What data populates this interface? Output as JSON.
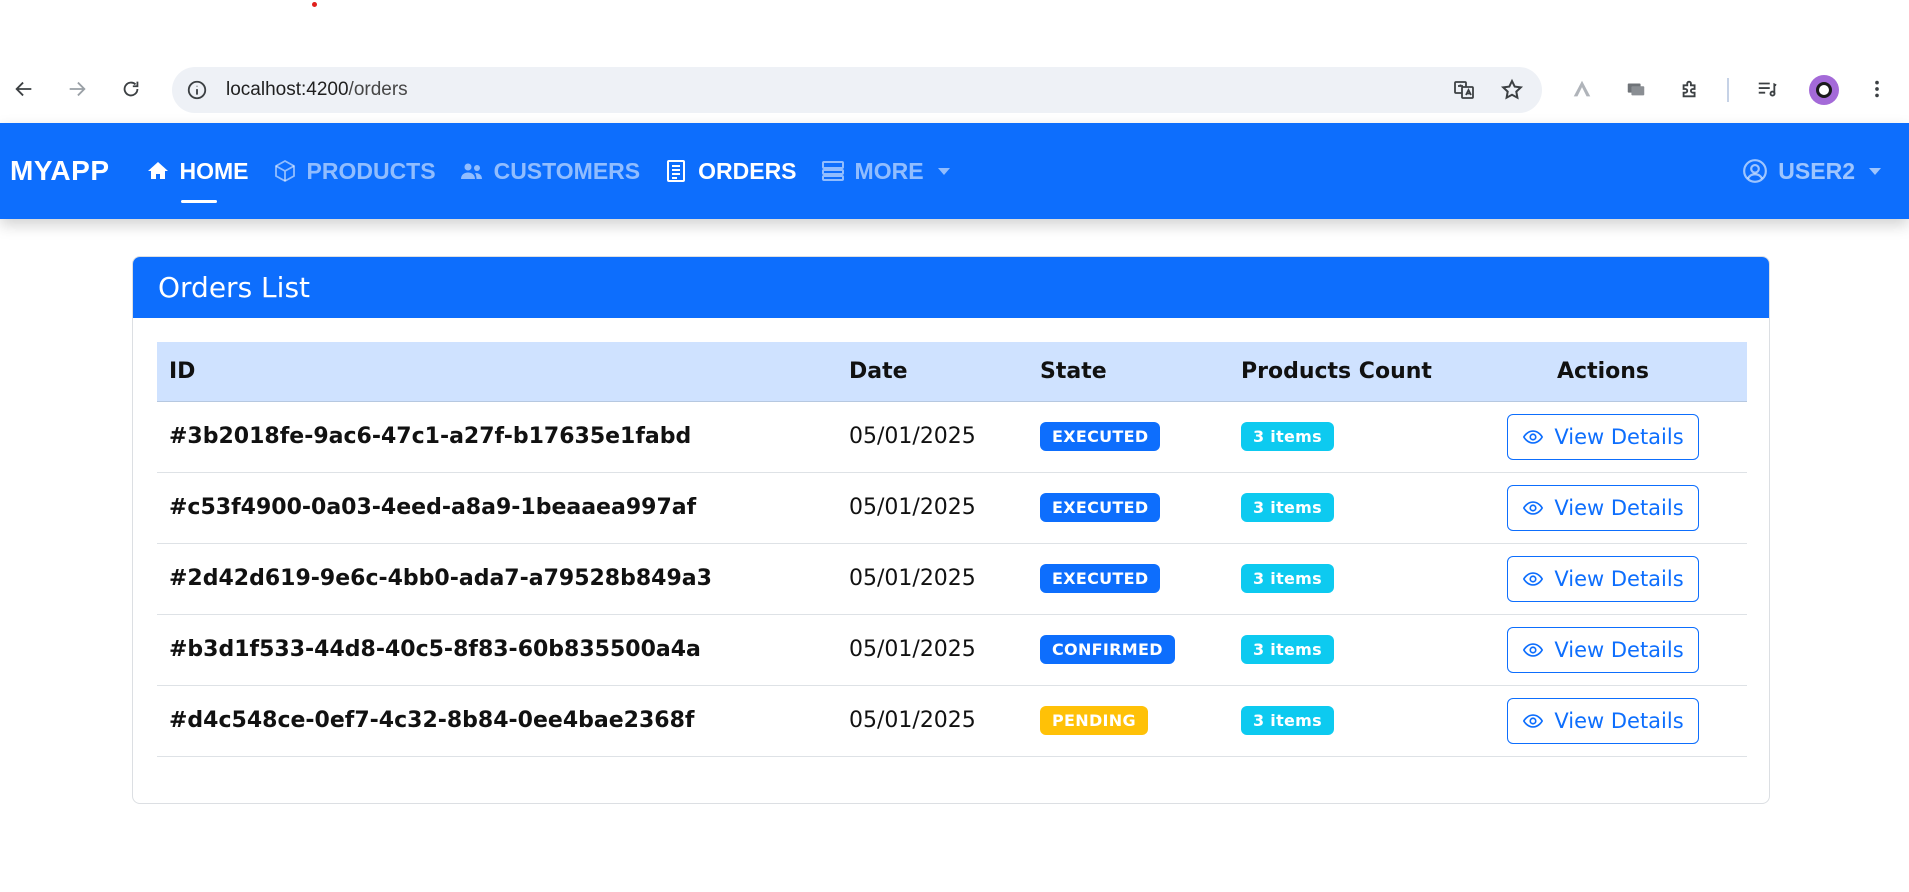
{
  "browser": {
    "url_host": "localhost:4200",
    "url_path": "/orders"
  },
  "navbar": {
    "brand": "MYAPP",
    "links": [
      {
        "label": "HOME",
        "icon": "home-icon",
        "active": true
      },
      {
        "label": "PRODUCTS",
        "icon": "box-icon"
      },
      {
        "label": "CUSTOMERS",
        "icon": "users-icon"
      },
      {
        "label": "ORDERS",
        "icon": "receipt-icon"
      },
      {
        "label": "MORE",
        "icon": "stack-icon"
      }
    ],
    "user_label": "USER2"
  },
  "card": {
    "title": "Orders List"
  },
  "table": {
    "columns": [
      "ID",
      "Date",
      "State",
      "Products Count",
      "Actions"
    ],
    "rows": [
      {
        "id": "#3b2018fe-9ac6-47c1-a27f-b17635e1fabd",
        "date": "05/01/2025",
        "state": "EXECUTED",
        "count": "3 items",
        "action": "View Details"
      },
      {
        "id": "#c53f4900-0a03-4eed-a8a9-1beaaea997af",
        "date": "05/01/2025",
        "state": "EXECUTED",
        "count": "3 items",
        "action": "View Details"
      },
      {
        "id": "#2d42d619-9e6c-4bb0-ada7-a79528b849a3",
        "date": "05/01/2025",
        "state": "EXECUTED",
        "count": "3 items",
        "action": "View Details"
      },
      {
        "id": "#b3d1f533-44d8-40c5-8f83-60b835500a4a",
        "date": "05/01/2025",
        "state": "CONFIRMED",
        "count": "3 items",
        "action": "View Details"
      },
      {
        "id": "#d4c548ce-0ef7-4c32-8b84-0ee4bae2368f",
        "date": "05/01/2025",
        "state": "PENDING",
        "count": "3 items",
        "action": "View Details"
      }
    ]
  },
  "colors": {
    "primary": "#0d6efd",
    "info": "#0dcaf0",
    "warning": "#ffc107",
    "table_header_bg": "#cfe2ff"
  }
}
